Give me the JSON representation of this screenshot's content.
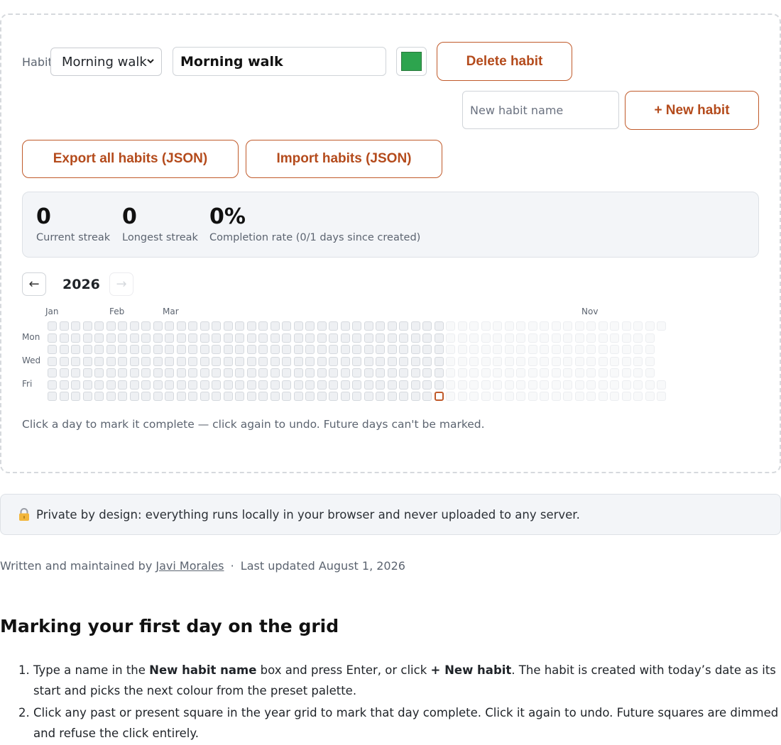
{
  "controls": {
    "habit_label": "Habit",
    "selected_habit": "Morning walk",
    "habit_name_value": "Morning walk",
    "habit_color": "#2da44e",
    "delete_label": "Delete habit",
    "new_habit_placeholder": "New habit name",
    "new_habit_label": "+ New habit",
    "export_label": "Export all habits (JSON)",
    "import_label": "Import habits (JSON)"
  },
  "stats": [
    {
      "value": "0",
      "caption": "Current streak"
    },
    {
      "value": "0",
      "caption": "Longest streak"
    },
    {
      "value": "0%",
      "caption": "Completion rate (0/1 days since created)"
    }
  ],
  "calendar": {
    "prev_icon": "←",
    "next_icon": "→",
    "year": "2026",
    "months": [
      "Jan",
      "Feb",
      "Mar",
      "Nov"
    ],
    "weekdays": [
      "Mon",
      "Wed",
      "Fri"
    ],
    "today_week": 33,
    "today_day": 6,
    "total_weeks": 53,
    "accent": "#c05a2a",
    "hint": "Click a day to mark it complete — click again to undo. Future days can't be marked."
  },
  "privacy": {
    "icon": "lock-icon",
    "text": "Private by design: everything runs locally in your browser and never uploaded to any server."
  },
  "byline": {
    "prefix": "Written and maintained by",
    "author": "Javi Morales",
    "separator": "·",
    "updated": "Last updated August 1, 2026"
  },
  "article": {
    "heading": "Marking your first day on the grid",
    "step1": {
      "a": "Type a name in the ",
      "b1": "New habit name",
      "c": " box and press Enter, or click ",
      "b2": "+ New habit",
      "d": ". The habit is created with today’s date as its start and picks the next colour from the preset palette."
    },
    "step2": "Click any past or present square in the year grid to mark that day complete. Click it again to undo. Future squares are dimmed and refuse the click entirely."
  }
}
